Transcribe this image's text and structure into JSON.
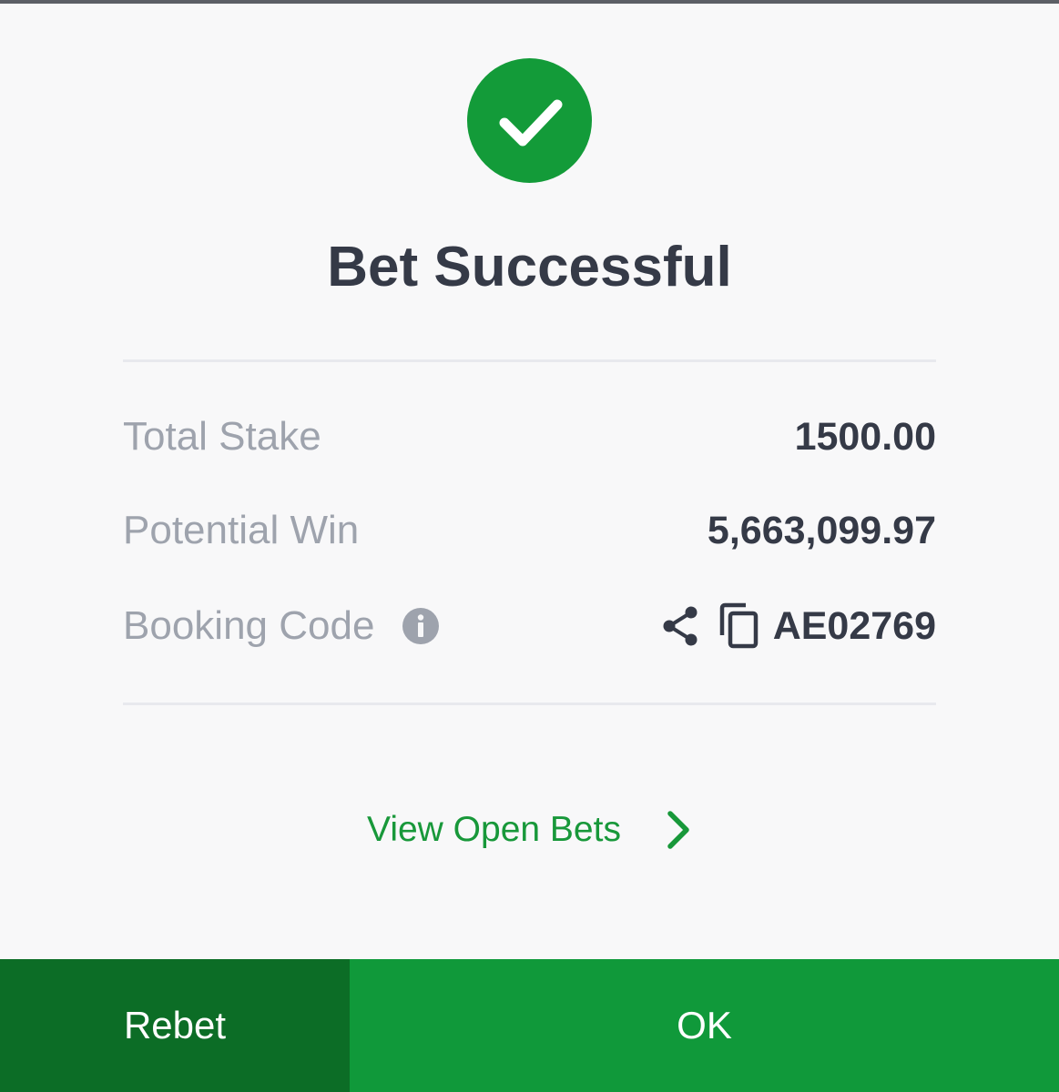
{
  "dialog": {
    "title": "Bet Successful"
  },
  "summary": {
    "stake_label": "Total Stake",
    "stake_value": "1500.00",
    "win_label": "Potential Win",
    "win_value": "5,663,099.97",
    "code_label": "Booking Code",
    "code_value": "AE02769"
  },
  "links": {
    "open_bets": "View Open Bets"
  },
  "footer": {
    "rebet_label": "Rebet",
    "ok_label": "OK"
  },
  "icons": {
    "success": "check-circle-icon",
    "info": "info-icon",
    "share": "share-icon",
    "copy": "copy-icon",
    "chevron": "chevron-right-icon"
  },
  "colors": {
    "primary_green": "#10993a",
    "dark_green": "#0c6d26",
    "title_text": "#353a47",
    "label_text": "#9ea3ad"
  }
}
